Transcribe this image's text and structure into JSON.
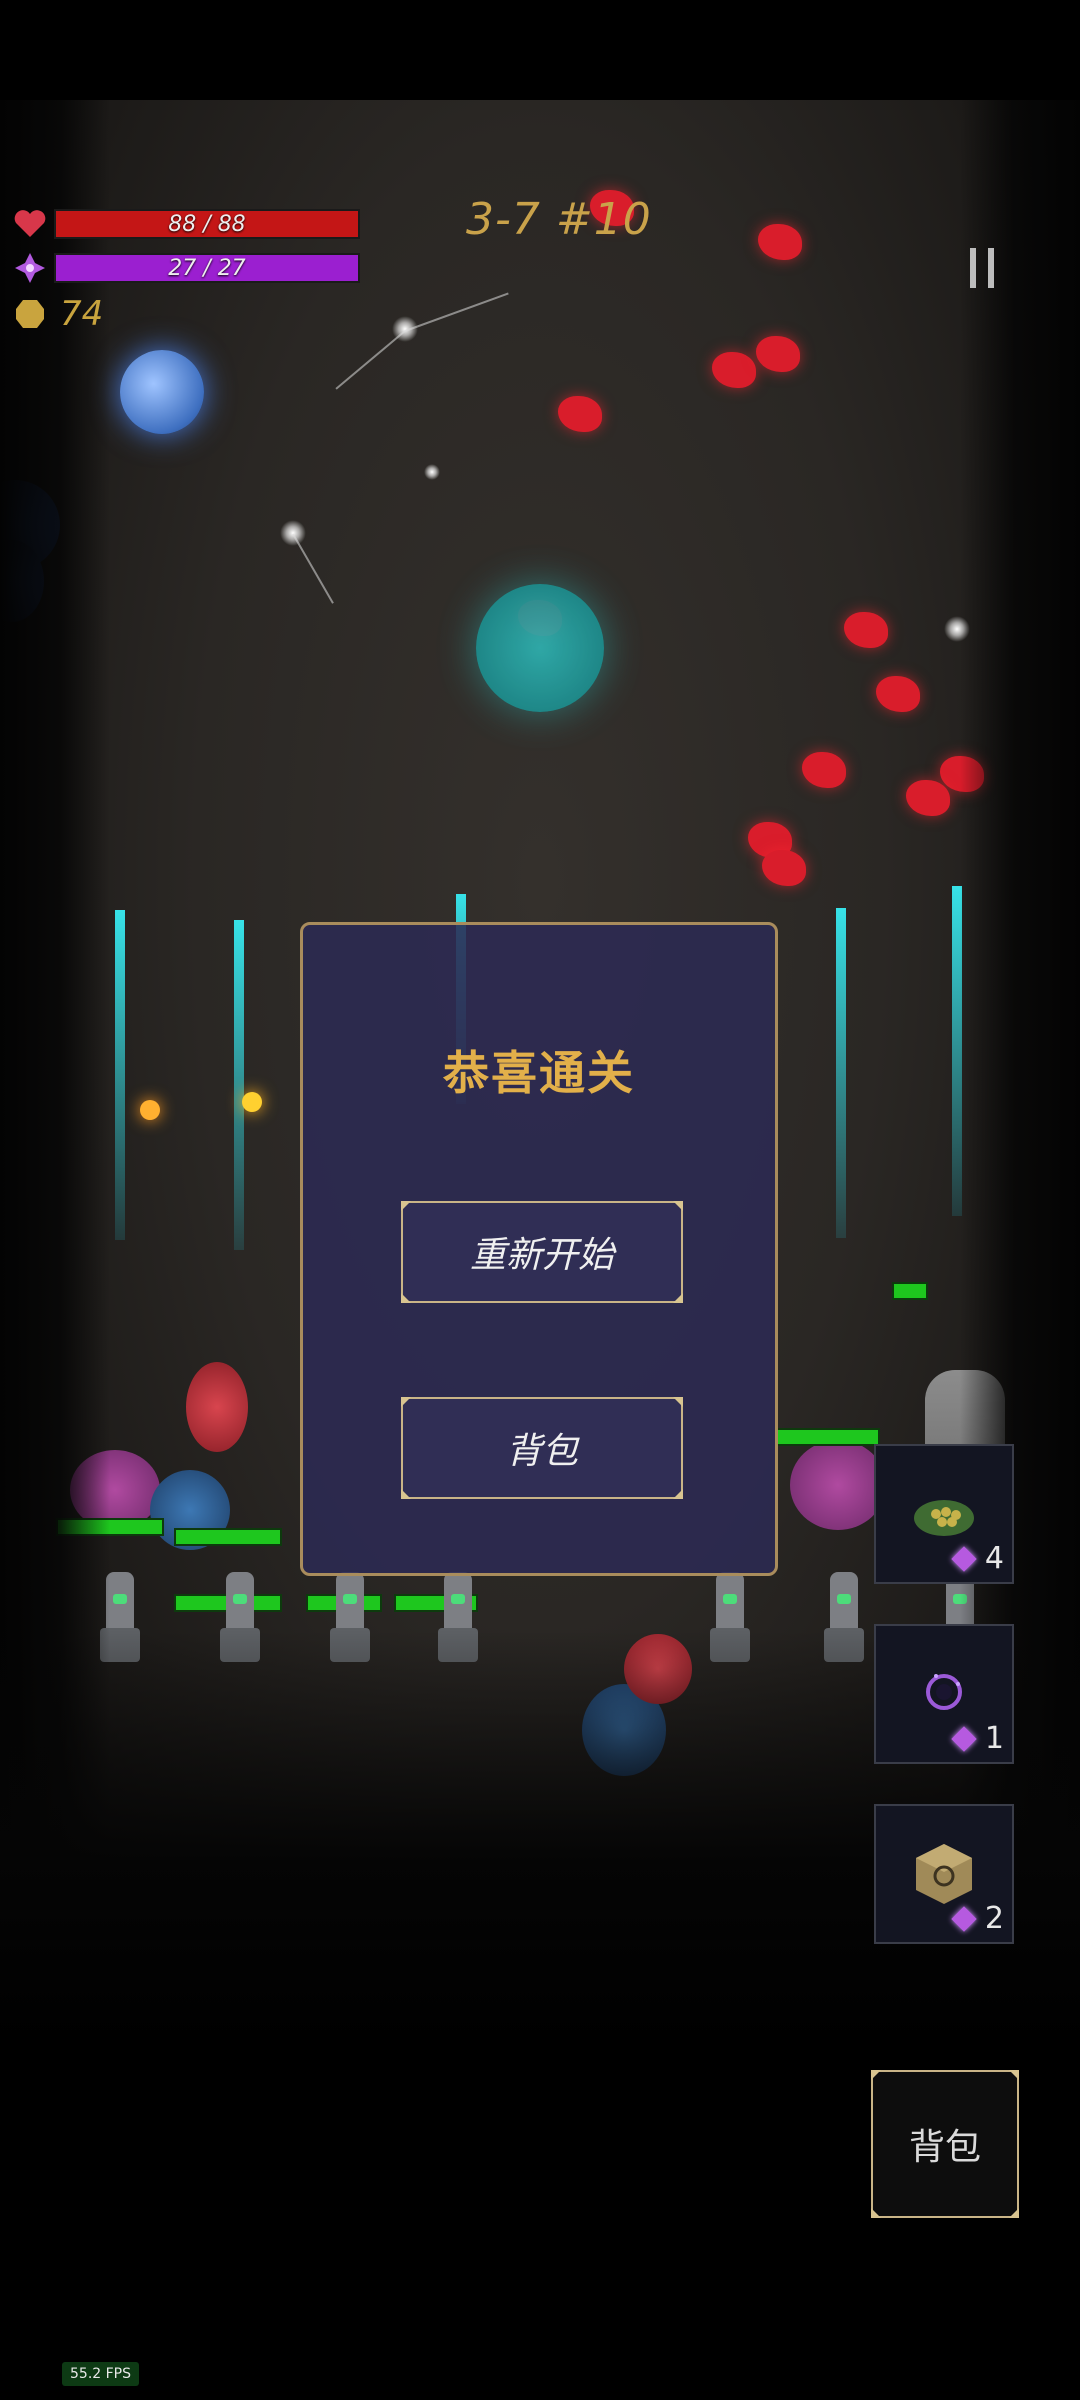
{
  "hud": {
    "hp_text": "88 / 88",
    "hp_fraction": 1.0,
    "mp_text": "27 / 27",
    "mp_fraction": 1.0,
    "gold": "74",
    "level": "3-7 #10",
    "heart_icon": "heart-icon",
    "mana_icon": "mana-gem-icon",
    "gold_icon": "gold-coin-icon",
    "pause_icon": "pause-icon"
  },
  "dialog": {
    "title": "恭喜通关",
    "restart_label": "重新开始",
    "bag_label": "背包"
  },
  "items": [
    {
      "icon": "turtle-shell-icon",
      "count": "4"
    },
    {
      "icon": "vortex-icon",
      "count": "1"
    },
    {
      "icon": "rune-cube-icon",
      "count": "2"
    }
  ],
  "bag_button": "背包",
  "fps": "55.2 FPS",
  "colors": {
    "hp": "#c41616",
    "mp": "#9b1fd0",
    "gold": "#c9a43e",
    "accent": "#e2b04a",
    "dialog_bg": "#2c2a54",
    "dialog_border": "#a98c5c"
  }
}
